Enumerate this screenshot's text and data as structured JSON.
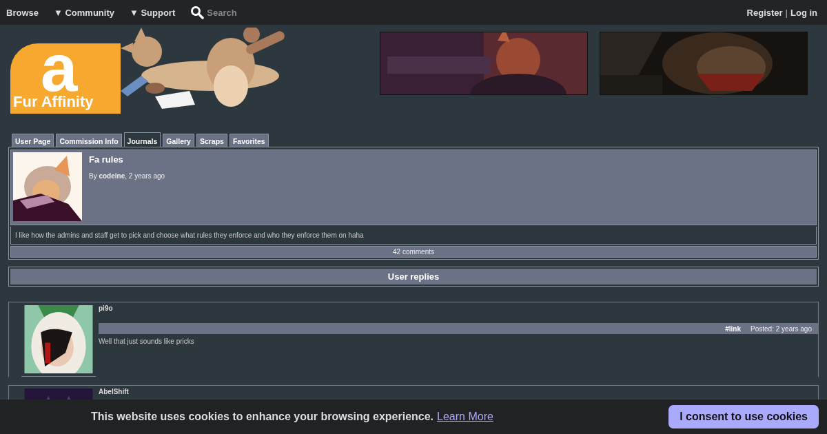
{
  "nav": {
    "items": [
      {
        "label": "Browse"
      },
      {
        "label": "▼ Community"
      },
      {
        "label": "▼ Support"
      }
    ],
    "search": {
      "placeholder": "Search"
    },
    "account": [
      {
        "label": "Register"
      },
      {
        "label": "Log in"
      }
    ],
    "separator": "|"
  },
  "logo": {
    "mark": "a",
    "text": "Fur Affinity"
  },
  "tabs": [
    {
      "label": "User Page",
      "selected": false
    },
    {
      "label": "Commission Info",
      "selected": false
    },
    {
      "label": "Journals",
      "selected": true
    },
    {
      "label": "Gallery",
      "selected": false
    },
    {
      "label": "Scraps",
      "selected": false
    },
    {
      "label": "Favorites",
      "selected": false
    }
  ],
  "journal": {
    "title": "Fa rules",
    "byline": "By **codeine**, 2 years ago",
    "body": "I like how the admins and staff get to pick and choose what rules they enforce and who they enforce them on haha",
    "comments": "42 comments"
  },
  "replies_header": "User replies",
  "comments": [
    {
      "user": "pi9o",
      "link": "#link",
      "posted": "Posted: 2 years ago",
      "text": "Well that just sounds like pricks"
    },
    {
      "user": "AbelShift"
    }
  ],
  "cookie_bar": {
    "text": "This website uses cookies to enhance your browsing experience.",
    "link": "Learn More",
    "button": "I consent to use cookies"
  }
}
